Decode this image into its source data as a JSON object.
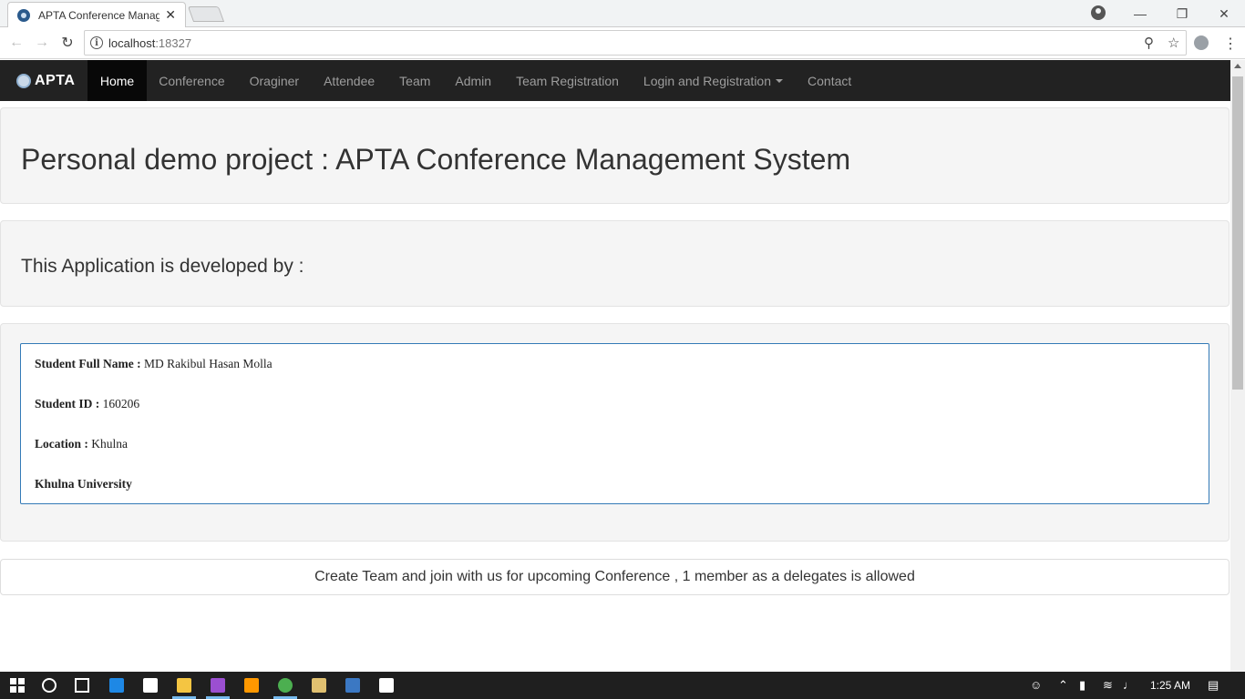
{
  "browser": {
    "tab_title": "APTA Conference Manag",
    "tab_close": "✕",
    "url_host": "localhost",
    "url_port": ":18327"
  },
  "navbar": {
    "brand": "APTA",
    "items": [
      {
        "label": "Home",
        "active": true
      },
      {
        "label": "Conference"
      },
      {
        "label": "Oraginer"
      },
      {
        "label": "Attendee"
      },
      {
        "label": "Team"
      },
      {
        "label": "Admin"
      },
      {
        "label": "Team Registration"
      },
      {
        "label": "Login and Registration",
        "dropdown": true
      },
      {
        "label": "Contact"
      }
    ]
  },
  "main": {
    "title": "Personal demo project : APTA Conference Management System",
    "subtitle": "This Application is developed by :",
    "developer": {
      "name_label": "Student Full Name :",
      "name_value": "MD Rakibul Hasan Molla",
      "id_label": "Student ID :",
      "id_value": "160206",
      "location_label": "Location :",
      "location_value": "Khulna",
      "university": "Khulna University"
    },
    "announcement": "Create Team and join with us for upcoming Conference , 1 member as a delegates is allowed"
  },
  "taskbar": {
    "clock": "1:25 AM",
    "app_colors": {
      "edge": "#1e88e5",
      "store": "#ffffff",
      "explorer": "#f4c542",
      "visual_studio": "#9b4fd1",
      "sublime": "#ff9800",
      "chrome": "#4caf50",
      "tool": "#e0c070",
      "azure": "#3b78c3",
      "mail": "#ffffff"
    }
  },
  "colors": {
    "navbar_bg": "#222222",
    "navbar_active": "#080808",
    "info_border": "#337ab7",
    "well_bg": "#f5f5f5"
  }
}
